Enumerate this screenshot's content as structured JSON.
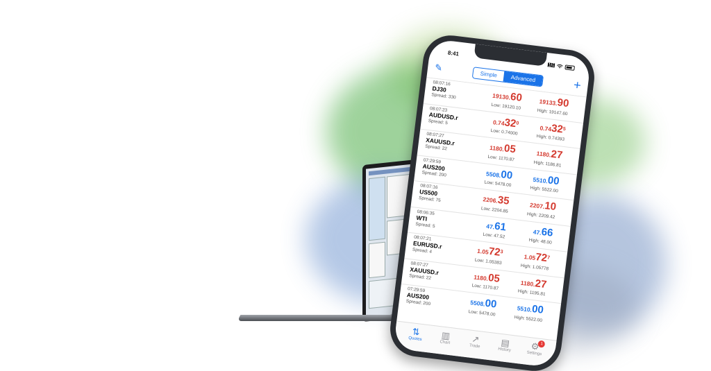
{
  "status": {
    "time": "8:41"
  },
  "toolbar": {
    "tabs": [
      "Simple",
      "Advanced"
    ],
    "active_tab": "Advanced",
    "add": "+",
    "edit_icon": "pencil-icon"
  },
  "quotes": [
    {
      "time": "08:07:16",
      "symbol": "DJ30",
      "spread": "Spread: 330",
      "bid_pre": "19130.",
      "bid_big": "60",
      "bid_sup": "",
      "ask_pre": "19133.",
      "ask_big": "90",
      "ask_sup": "",
      "low": "Low: 19120.10",
      "high": "High: 19147.60",
      "dir": "down"
    },
    {
      "time": "08:07:23",
      "symbol": "AUDUSD.r",
      "spread": "Spread: 5",
      "bid_pre": "0.74",
      "bid_big": "32",
      "bid_sup": "0",
      "ask_pre": "0.74",
      "ask_big": "32",
      "ask_sup": "5",
      "low": "Low: 0.74000",
      "high": "High: 0.74393",
      "dir": "down"
    },
    {
      "time": "08:07:27",
      "symbol": "XAUUSD.r",
      "spread": "Spread: 22",
      "bid_pre": "1180.",
      "bid_big": "05",
      "bid_sup": "",
      "ask_pre": "1180.",
      "ask_big": "27",
      "ask_sup": "",
      "low": "Low: 1170.87",
      "high": "High: 1186.81",
      "dir": "down"
    },
    {
      "time": "07:29:59",
      "symbol": "AUS200",
      "spread": "Spread: 200",
      "bid_pre": "5508.",
      "bid_big": "00",
      "bid_sup": "",
      "ask_pre": "5510.",
      "ask_big": "00",
      "ask_sup": "",
      "low": "Low: 5478.00",
      "high": "High: 5522.00",
      "dir": "up"
    },
    {
      "time": "08:07:16",
      "symbol": "US500",
      "spread": "Spread: 75",
      "bid_pre": "2206.",
      "bid_big": "35",
      "bid_sup": "",
      "ask_pre": "2207.",
      "ask_big": "10",
      "ask_sup": "",
      "low": "Low: 2204.85",
      "high": "High: 2209.42",
      "dir": "down"
    },
    {
      "time": "08:06:35",
      "symbol": "WTI",
      "spread": "Spread: 5",
      "bid_pre": "47.",
      "bid_big": "61",
      "bid_sup": "",
      "ask_pre": "47.",
      "ask_big": "66",
      "ask_sup": "",
      "low": "Low: 47.52",
      "high": "High: 48.00",
      "dir": "up"
    },
    {
      "time": "08:07:21",
      "symbol": "EURUSD.r",
      "spread": "Spread: 4",
      "bid_pre": "1.05",
      "bid_big": "72",
      "bid_sup": "3",
      "ask_pre": "1.05",
      "ask_big": "72",
      "ask_sup": "7",
      "low": "Low: 1.05383",
      "high": "High: 1.05778",
      "dir": "down"
    },
    {
      "time": "08:07:27",
      "symbol": "XAUUSD.r",
      "spread": "Spread: 22",
      "bid_pre": "1180.",
      "bid_big": "05",
      "bid_sup": "",
      "ask_pre": "1180.",
      "ask_big": "27",
      "ask_sup": "",
      "low": "Low: 1170.87",
      "high": "High: 1195.81",
      "dir": "down"
    },
    {
      "time": "07:29:59",
      "symbol": "AUS200",
      "spread": "Spread: 200",
      "bid_pre": "5508.",
      "bid_big": "00",
      "bid_sup": "",
      "ask_pre": "5510.",
      "ask_big": "00",
      "ask_sup": "",
      "low": "Low: 5478.00",
      "high": "High: 5522.00",
      "dir": "up"
    }
  ],
  "tabbar": [
    {
      "label": "Quotes",
      "icon": "quotes-icon",
      "active": true
    },
    {
      "label": "Chart",
      "icon": "chart-icon",
      "active": false
    },
    {
      "label": "Trade",
      "icon": "trade-icon",
      "active": false
    },
    {
      "label": "History",
      "icon": "history-icon",
      "active": false
    },
    {
      "label": "Settings",
      "icon": "settings-icon",
      "active": false,
      "badge": "1"
    }
  ],
  "colors": {
    "accent": "#1a73e8",
    "down": "#d43a2f",
    "up": "#1a73e8"
  }
}
